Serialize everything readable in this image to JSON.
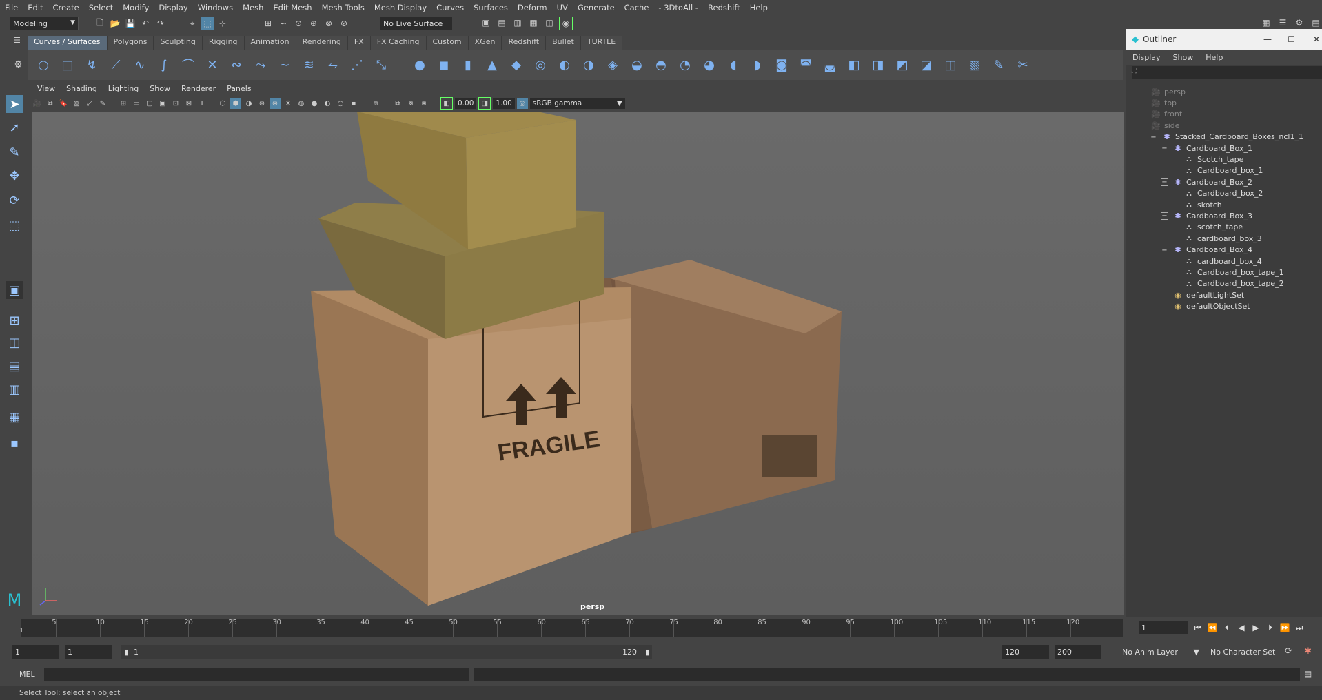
{
  "menubar": {
    "items": [
      "File",
      "Edit",
      "Create",
      "Select",
      "Modify",
      "Display",
      "Windows",
      "Mesh",
      "Edit Mesh",
      "Mesh Tools",
      "Mesh Display",
      "Curves",
      "Surfaces",
      "Deform",
      "UV",
      "Generate",
      "Cache",
      "- 3DtoAll -",
      "Redshift",
      "Help"
    ]
  },
  "mode_selector": {
    "value": "Modeling"
  },
  "live_surface": {
    "value": "No Live Surface"
  },
  "shelf_tabs": [
    "Curves / Surfaces",
    "Polygons",
    "Sculpting",
    "Rigging",
    "Animation",
    "Rendering",
    "FX",
    "FX Caching",
    "Custom",
    "XGen",
    "Redshift",
    "Bullet",
    "TURTLE"
  ],
  "shelf_active_tab": "Curves / Surfaces",
  "viewport": {
    "menu": [
      "View",
      "Shading",
      "Lighting",
      "Show",
      "Renderer",
      "Panels"
    ],
    "exposure": "0.00",
    "gamma": "1.00",
    "color_space": "sRGB gamma",
    "camera_label": "persp",
    "scene_text": {
      "fragile": "FRAGILE"
    }
  },
  "outliner": {
    "title": "Outliner",
    "menu": [
      "Display",
      "Show",
      "Help"
    ],
    "items": [
      {
        "label": "persp",
        "icon": "camera-icon"
      },
      {
        "label": "top",
        "icon": "camera-icon"
      },
      {
        "label": "front",
        "icon": "camera-icon"
      },
      {
        "label": "side",
        "icon": "camera-icon"
      },
      {
        "label": "Stacked_Cardboard_Boxes_ncl1_1",
        "icon": "group-icon"
      },
      {
        "label": "Cardboard_Box_1",
        "icon": "group-icon"
      },
      {
        "label": "Scotch_tape",
        "icon": "mesh-icon"
      },
      {
        "label": "Cardboard_box_1",
        "icon": "mesh-icon"
      },
      {
        "label": "Cardboard_Box_2",
        "icon": "group-icon"
      },
      {
        "label": "Cardboard_box_2",
        "icon": "mesh-icon"
      },
      {
        "label": "skotch",
        "icon": "mesh-icon"
      },
      {
        "label": "Cardboard_Box_3",
        "icon": "group-icon"
      },
      {
        "label": "scotch_tape",
        "icon": "mesh-icon"
      },
      {
        "label": "cardboard_box_3",
        "icon": "mesh-icon"
      },
      {
        "label": "Cardboard_Box_4",
        "icon": "group-icon"
      },
      {
        "label": "cardboard_box_4",
        "icon": "mesh-icon"
      },
      {
        "label": "Cardboard_box_tape_1",
        "icon": "mesh-icon"
      },
      {
        "label": "Cardboard_box_tape_2",
        "icon": "mesh-icon"
      },
      {
        "label": "defaultLightSet",
        "icon": "set-icon"
      },
      {
        "label": "defaultObjectSet",
        "icon": "set-icon"
      }
    ]
  },
  "timeline": {
    "ticks": [
      "5",
      "10",
      "15",
      "20",
      "25",
      "30",
      "35",
      "40",
      "45",
      "50",
      "55",
      "60",
      "65",
      "70",
      "75",
      "80",
      "85",
      "90",
      "95",
      "100",
      "105",
      "110",
      "115",
      "120"
    ],
    "start_label": "1",
    "current_frame": "1"
  },
  "range": {
    "start": "1",
    "playback_start": "1",
    "slider_start": "1",
    "slider_end": "120",
    "playback_end": "120",
    "end": "200",
    "anim_layer": "No Anim Layer",
    "char_set": "No Character Set"
  },
  "cmdline": {
    "label": "MEL"
  },
  "help_line": {
    "text": "Select Tool: select an object"
  }
}
